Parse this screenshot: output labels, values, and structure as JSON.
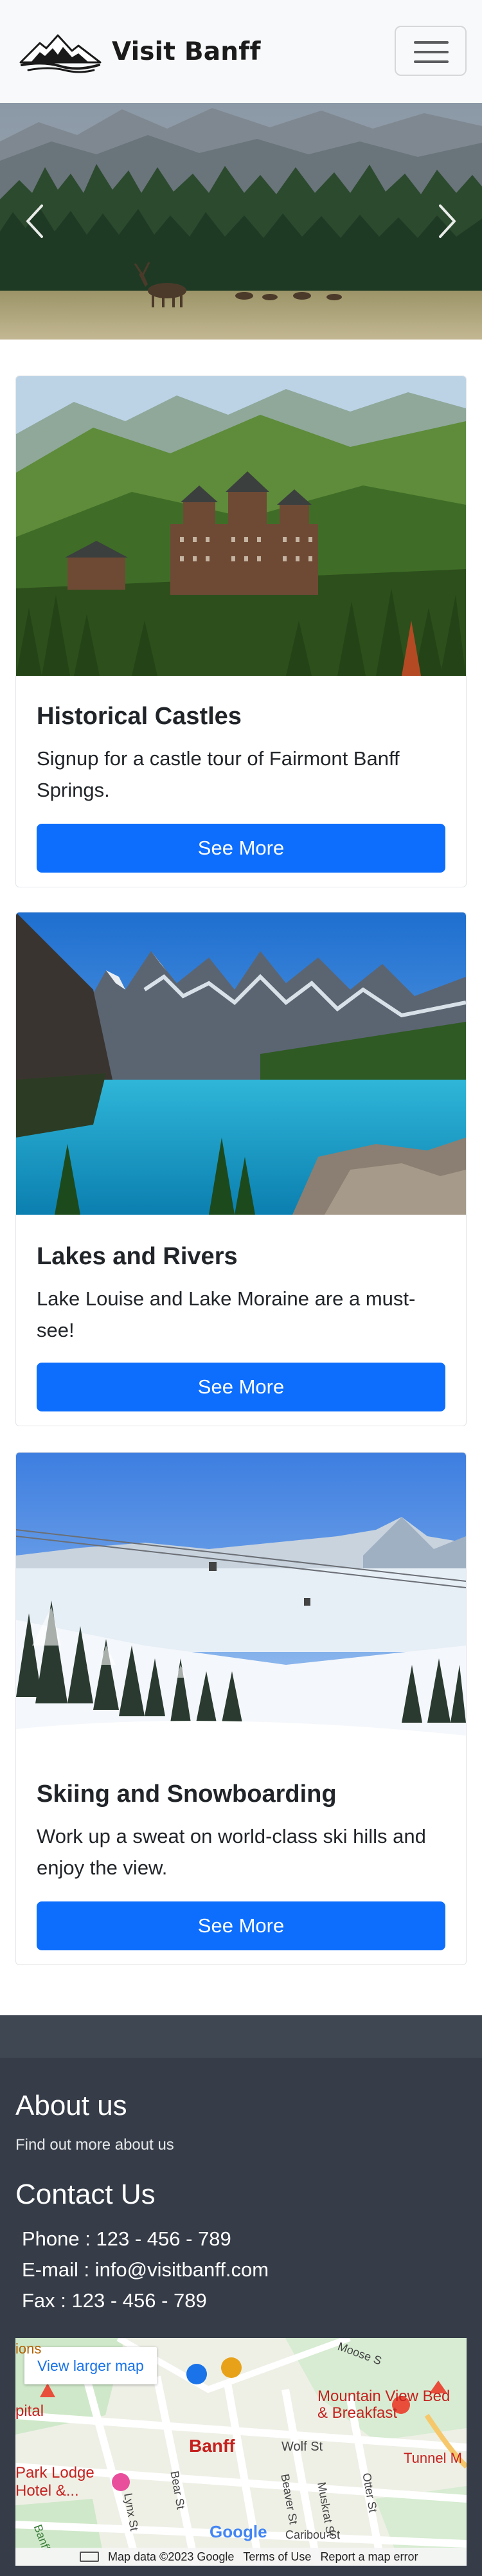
{
  "navbar": {
    "brand": "Visit Banff"
  },
  "carousel": {
    "prev_icon": "chevron-left-icon",
    "next_icon": "chevron-right-icon"
  },
  "cards": [
    {
      "title": "Historical Castles",
      "text": "Signup for a castle tour of Fairmont Banff Springs.",
      "button": "See More"
    },
    {
      "title": "Lakes and Rivers",
      "text": "Lake Louise and Lake Moraine are a must-see!",
      "button": "See More"
    },
    {
      "title": "Skiing and Snowboarding",
      "text": "Work up a sweat on world-class ski hills and enjoy the view.",
      "button": "See More"
    }
  ],
  "footer": {
    "about_heading": "About us",
    "about_text": "Find out more about us",
    "contact_heading": "Contact Us",
    "phone": "Phone : 123 - 456 - 789",
    "email": "E-mail : info@visitbanff.com",
    "fax": "Fax : 123 - 456 - 789"
  },
  "map": {
    "larger_map_link": "View larger map",
    "labels": {
      "town": "Banff",
      "hotel": "Mountain View Bed & Breakfast",
      "lodge": "Park Lodge Hotel &...",
      "tunnel": "Tunnel M",
      "wolf": "Wolf St",
      "caribou": "Caribou St",
      "beaver": "Beaver St",
      "muskrat": "Muskrat St",
      "otter": "Otter St",
      "bear": "Bear St",
      "lynx": "Lynx St",
      "moose": "Moose S",
      "capital": "pital",
      "ions": "ions",
      "banff_park": "Banff",
      "google": "Google"
    },
    "attribution": "Map data ©2023 Google",
    "terms": "Terms of Use",
    "report": "Report a map error"
  }
}
